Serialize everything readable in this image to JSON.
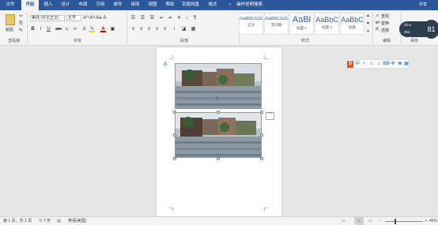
{
  "menubar": {
    "tabs": [
      "文件",
      "开始",
      "插入",
      "设计",
      "布局",
      "引用",
      "邮件",
      "审阅",
      "视图",
      "帮助",
      "百度网盘",
      "格式"
    ],
    "active_tab": "开始",
    "tell_me": "操作说明搜索",
    "user": "共享"
  },
  "ribbon": {
    "clipboard": {
      "paste_label": "粘贴",
      "group_label": "剪贴板"
    },
    "font": {
      "font_name": "等线 (中文正文)",
      "font_size": "五号",
      "group_label": "字体",
      "format_buttons": [
        "B",
        "I",
        "U",
        "abc",
        "x₂",
        "x²",
        "A"
      ],
      "size_buttons": [
        "A^",
        "A˅",
        "Aa",
        "A"
      ]
    },
    "paragraph": {
      "group_label": "段落"
    },
    "styles": {
      "group_label": "样式",
      "items": [
        {
          "sample": "AaBbCcDc",
          "name": "正文"
        },
        {
          "sample": "AaBbCcDc",
          "name": "无间隔"
        },
        {
          "sample": "AaBl",
          "name": "标题 1"
        },
        {
          "sample": "AaBbC",
          "name": "标题 2"
        },
        {
          "sample": "AaBbC",
          "name": "标题"
        }
      ]
    },
    "editing": {
      "group_label": "编辑",
      "find": "查找",
      "replace": "替换",
      "select": "选择"
    },
    "save": {
      "group_label": "保存"
    }
  },
  "speed_widget": {
    "up": "20.6",
    "down": "364",
    "percent": "81"
  },
  "statusbar": {
    "page": "第 1 页，共 1 页",
    "words": "0 个字",
    "language": "英语(美国)",
    "zoom": "46%"
  },
  "colors": {
    "menubar": "#2b579a",
    "ribbon": "#f3f3f3",
    "doc_bg": "#e6e6e6"
  }
}
